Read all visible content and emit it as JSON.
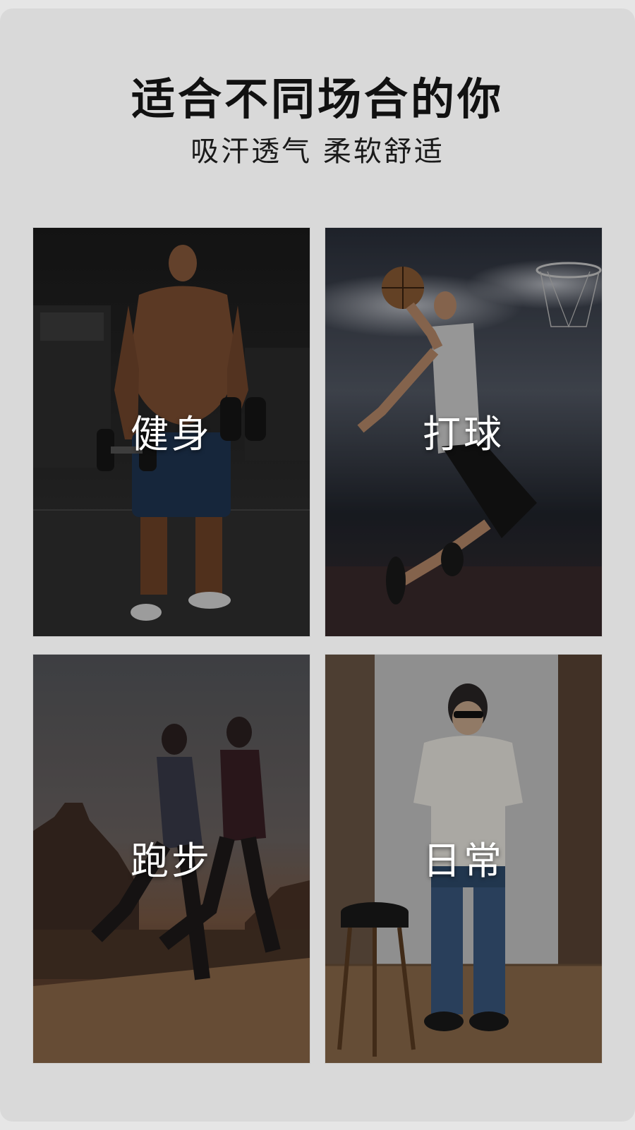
{
  "header": {
    "title": "适合不同场合的你",
    "subtitle": "吸汗透气 柔软舒适"
  },
  "tiles": [
    {
      "label": "健身",
      "scene": "man holding dumbbells in a gym"
    },
    {
      "label": "打球",
      "scene": "basketball player jumping toward hoop"
    },
    {
      "label": "跑步",
      "scene": "two runners at sunset"
    },
    {
      "label": "日常",
      "scene": "man in white t-shirt and jeans standing by a stool"
    }
  ]
}
